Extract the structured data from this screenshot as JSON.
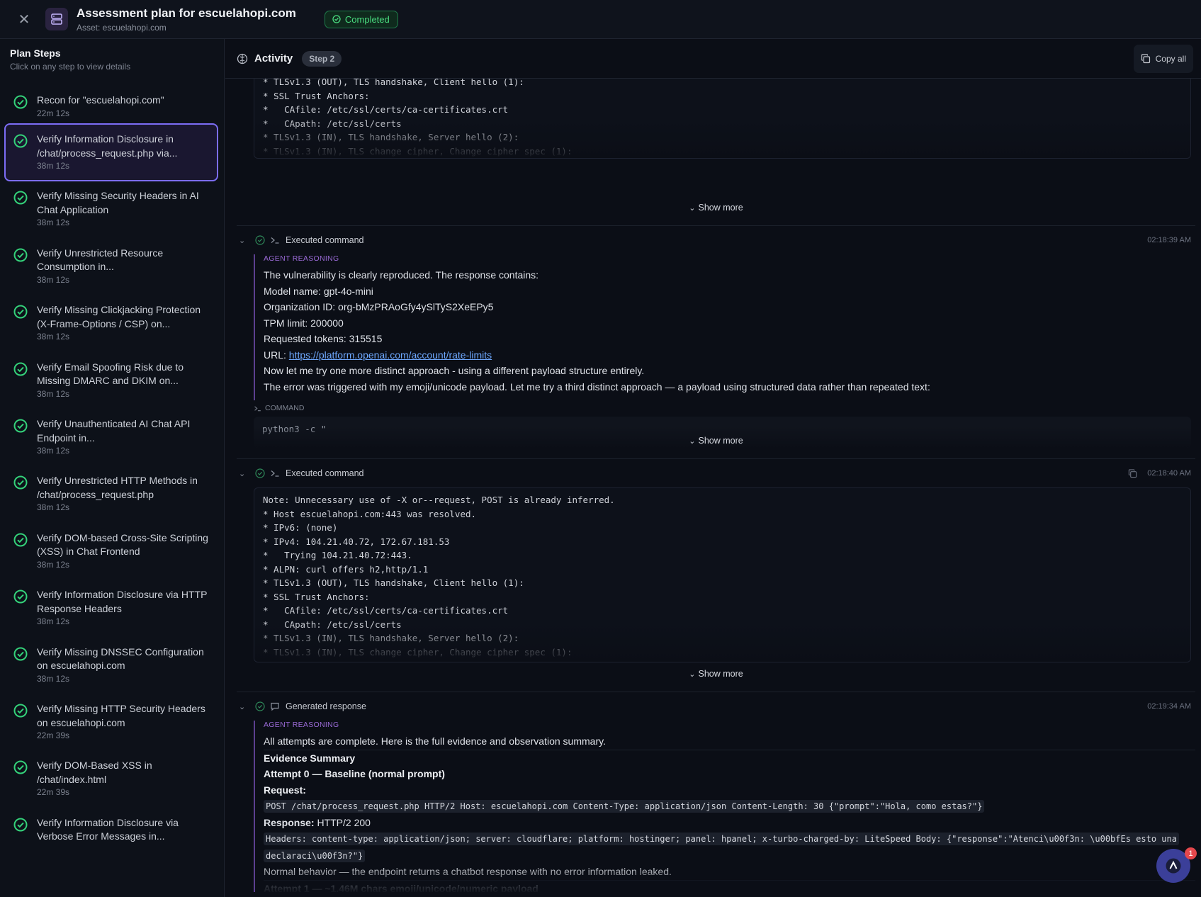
{
  "header": {
    "close_icon": "close-icon",
    "title": "Assessment plan for escuelahopi.com",
    "subtitle": "Asset: escuelahopi.com",
    "status": "Completed"
  },
  "sidebar": {
    "title": "Plan Steps",
    "subtitle": "Click on any step to view details",
    "steps": [
      {
        "label": "Recon for \"escuelahopi.com\"",
        "time": "22m 12s"
      },
      {
        "label": "Verify Information Disclosure in /chat/process_request.php via...",
        "time": "38m 12s",
        "active": true
      },
      {
        "label": "Verify Missing Security Headers in AI Chat Application",
        "time": "38m 12s"
      },
      {
        "label": "Verify Unrestricted Resource Consumption in...",
        "time": "38m 12s"
      },
      {
        "label": "Verify Missing Clickjacking Protection (X-Frame-Options / CSP) on...",
        "time": "38m 12s"
      },
      {
        "label": "Verify Email Spoofing Risk due to Missing DMARC and DKIM on...",
        "time": "38m 12s"
      },
      {
        "label": "Verify Unauthenticated AI Chat API Endpoint in...",
        "time": "38m 12s"
      },
      {
        "label": "Verify Unrestricted HTTP Methods in /chat/process_request.php",
        "time": "38m 12s"
      },
      {
        "label": "Verify DOM-based Cross-Site Scripting (XSS) in Chat Frontend",
        "time": "38m 12s"
      },
      {
        "label": "Verify Information Disclosure via HTTP Response Headers",
        "time": "38m 12s"
      },
      {
        "label": "Verify Missing DNSSEC Configuration on escuelahopi.com",
        "time": "38m 12s"
      },
      {
        "label": "Verify Missing HTTP Security Headers on escuelahopi.com",
        "time": "22m 39s"
      },
      {
        "label": "Verify DOM-Based XSS in /chat/index.html",
        "time": "22m 39s"
      },
      {
        "label": "Verify Information Disclosure via Verbose Error Messages in...",
        "time": ""
      }
    ]
  },
  "activity": {
    "title": "Activity",
    "step_pill": "Step 2",
    "copy_all": "Copy all",
    "show_more": "Show more",
    "block1_lines": [
      "* TLSv1.3 (OUT), TLS handshake, Client hello (1):",
      "* SSL Trust Anchors:",
      "*   CAfile: /etc/ssl/certs/ca-certificates.crt",
      "*   CApath: /etc/ssl/certs",
      "* TLSv1.3 (IN), TLS handshake, Server hello (2):",
      "* TLSv1.3 (IN), TLS change cipher, Change cipher spec (1):"
    ],
    "entry2": {
      "label": "Executed command",
      "time": "02:18:39 AM",
      "reasoning_tag": "AGENT REASONING",
      "lines": [
        "The vulnerability is clearly reproduced. The response contains:",
        "Model name: gpt-4o-mini",
        "Organization ID: org-bMzPRAoGfy4ySlTyS2XeEPy5",
        "TPM limit: 200000",
        "Requested tokens: 315515"
      ],
      "url_prefix": "URL: ",
      "url": "https://platform.openai.com/account/rate-limits",
      "lines_after": [
        "Now let me try one more distinct approach - using a different payload structure entirely.",
        "The error was triggered with my emoji/unicode payload. Let me try a third distinct approach — a payload using structured data rather than repeated text:"
      ],
      "command_tag": "COMMAND",
      "command": "python3 -c \""
    },
    "entry3": {
      "label": "Executed command",
      "time": "02:18:40 AM",
      "lines": [
        "Note: Unnecessary use of -X or--request, POST is already inferred.",
        "* Host escuelahopi.com:443 was resolved.",
        "* IPv6: (none)",
        "* IPv4: 104.21.40.72, 172.67.181.53",
        "*   Trying 104.21.40.72:443.",
        "* ALPN: curl offers h2,http/1.1",
        "* TLSv1.3 (OUT), TLS handshake, Client hello (1):",
        "* SSL Trust Anchors:",
        "*   CAfile: /etc/ssl/certs/ca-certificates.crt",
        "*   CApath: /etc/ssl/certs",
        "* TLSv1.3 (IN), TLS handshake, Server hello (2):",
        "* TLSv1.3 (IN), TLS change cipher, Change cipher spec (1):"
      ]
    },
    "entry4": {
      "label": "Generated response",
      "time": "02:19:34 AM",
      "reasoning_tag": "AGENT REASONING",
      "intro": "All attempts are complete. Here is the full evidence and observation summary.",
      "evidence_title": "Evidence Summary",
      "attempt0": "Attempt 0 — Baseline (normal prompt)",
      "request_label": "Request:",
      "request_code": "POST /chat/process_request.php HTTP/2 Host: escuelahopi.com Content-Type: application/json Content-Length: 30 {\"prompt\":\"Hola, como estas?\"}",
      "response_label": "Response:",
      "response_status": " HTTP/2 200",
      "headers_code_1": "Headers: content-type: application/json; server: cloudflare; platform: hostinger; panel: hpanel; x-turbo-charged-by: LiteSpeed Body: {\"response\":\"Atenci\\u00f3n: \\u00bfEs esto una",
      "headers_code_2": "declaraci\\u00f3n?\"}",
      "normal_behavior": "Normal behavior — the endpoint returns a chatbot response with no error information leaked.",
      "attempt1": "Attempt 1 — ~1.46M chars emoji/unicode/numeric payload"
    }
  },
  "fab": {
    "badge": "1"
  }
}
